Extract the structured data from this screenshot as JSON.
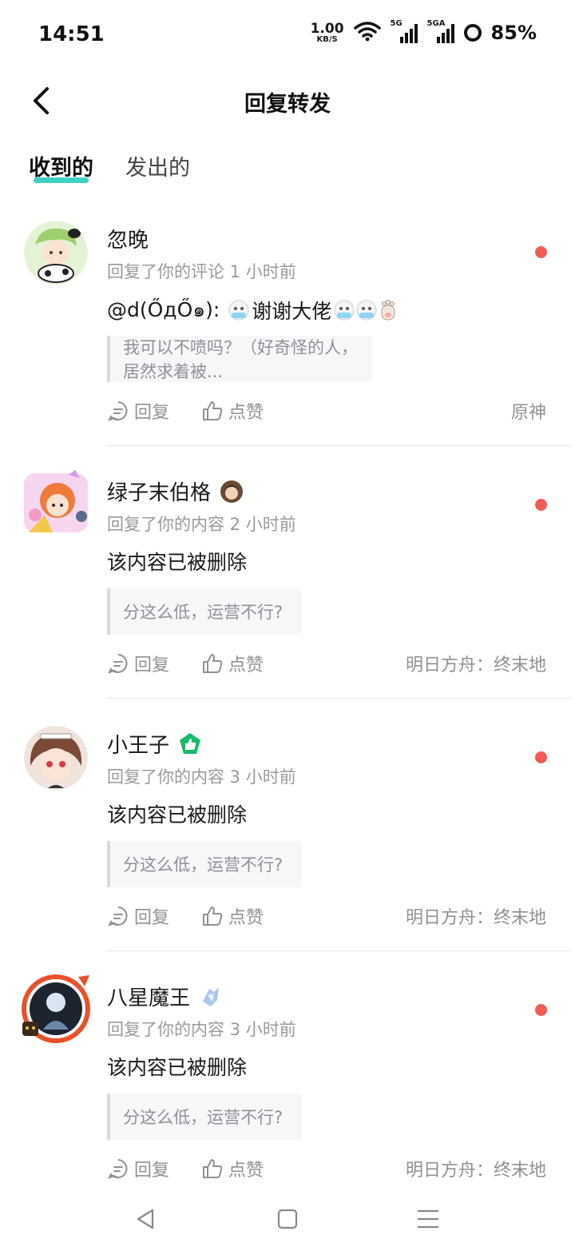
{
  "status_bar": {
    "time": "14:51",
    "net_speed_value": "1.00",
    "net_speed_unit": "KB/S",
    "sim1_label": "5G",
    "sim2_label": "5GA",
    "battery": "85%"
  },
  "header": {
    "title": "回复转发"
  },
  "tabs": [
    {
      "label": "收到的",
      "active": true
    },
    {
      "label": "发出的",
      "active": false
    }
  ],
  "items": [
    {
      "username": "忽晚",
      "meta": "回复了你的评论 1 小时前",
      "content": "@d(ŐдŐ๑): ",
      "content_suffix": "谢谢大佬",
      "quote": "我可以不喷吗？（好奇怪的人，居然求着被...",
      "reply_label": "回复",
      "like_label": "点赞",
      "source": "原神",
      "unread": true
    },
    {
      "username": "绿子末伯格",
      "meta": "回复了你的内容 2 小时前",
      "content": "该内容已被删除",
      "quote": "分这么低，运营不行?",
      "reply_label": "回复",
      "like_label": "点赞",
      "source": "明日方舟：终末地",
      "unread": true
    },
    {
      "username": "小王子",
      "meta": "回复了你的内容 3 小时前",
      "content": "该内容已被删除",
      "quote": "分这么低，运营不行?",
      "reply_label": "回复",
      "like_label": "点赞",
      "source": "明日方舟：终末地",
      "unread": true
    },
    {
      "username": "八星魔王",
      "meta": "回复了你的内容 3 小时前",
      "content": "该内容已被删除",
      "quote": "分这么低，运营不行?",
      "reply_label": "回复",
      "like_label": "点赞",
      "source": "明日方舟：终末地",
      "unread": true
    }
  ],
  "colors": {
    "accent": "#3ed2c2",
    "unread_dot": "#f25c54",
    "badge_green": "#19b96a"
  }
}
